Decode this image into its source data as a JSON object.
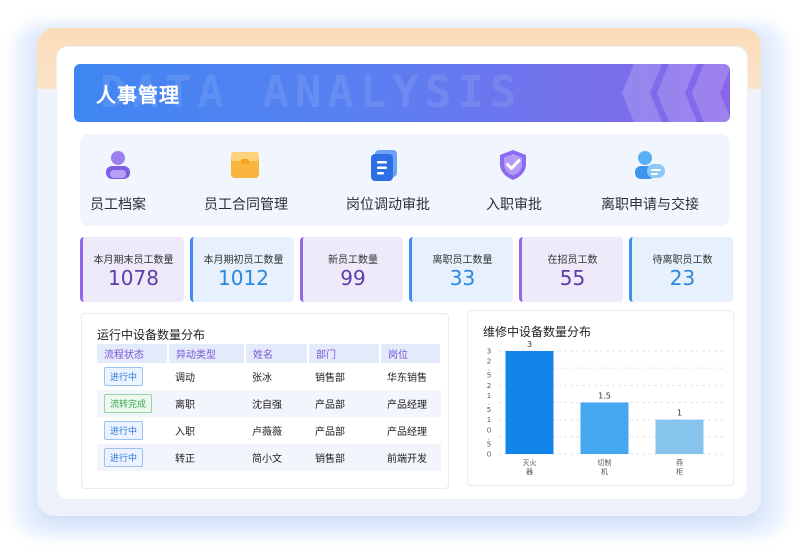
{
  "header": {
    "title": "人事管理",
    "watermark": "DATA ANALYSIS"
  },
  "menu": [
    {
      "label": "员工档案",
      "icon": "user-profile-icon"
    },
    {
      "label": "员工合同管理",
      "icon": "contract-folder-icon"
    },
    {
      "label": "岗位调动审批",
      "icon": "document-icon"
    },
    {
      "label": "入职审批",
      "icon": "shield-check-icon"
    },
    {
      "label": "离职申请与交接",
      "icon": "user-exit-icon"
    }
  ],
  "stats": [
    {
      "label": "本月期末员工数量",
      "value": "1078"
    },
    {
      "label": "本月期初员工数量",
      "value": "1012"
    },
    {
      "label": "新员工数量",
      "value": "99"
    },
    {
      "label": "离职员工数量",
      "value": "33"
    },
    {
      "label": "在招员工数",
      "value": "55"
    },
    {
      "label": "待离职员工数",
      "value": "23"
    }
  ],
  "table_panel": {
    "title": "运行中设备数量分布",
    "columns": [
      "流程状态",
      "异动类型",
      "姓名",
      "部门",
      "岗位"
    ],
    "rows": [
      [
        "进行中",
        "调动",
        "张冰",
        "销售部",
        "华东销售"
      ],
      [
        "流转完成",
        "离职",
        "沈自强",
        "产品部",
        "产品经理"
      ],
      [
        "进行中",
        "入职",
        "卢薇薇",
        "产品部",
        "产品经理"
      ],
      [
        "进行中",
        "转正",
        "简小文",
        "销售部",
        "前端开发"
      ]
    ]
  },
  "chart_panel": {
    "title": "维修中设备数量分布"
  },
  "chart_data": {
    "type": "bar",
    "title": "维修中设备数量分布",
    "categories": [
      "灭火器",
      "切制机",
      "燕柜"
    ],
    "category_label_lines": [
      [
        "灭火",
        "器"
      ],
      [
        "切制",
        "机"
      ],
      [
        "燕",
        "柜"
      ]
    ],
    "values": [
      3,
      1.5,
      1
    ],
    "data_labels": [
      "3",
      "1.5",
      "1"
    ],
    "yticks": [
      "0",
      "0.5",
      "1",
      "1.5",
      "2",
      "2.5",
      "3"
    ],
    "ylim": [
      0,
      3
    ],
    "grid": true,
    "colors": [
      "#1384ea",
      "#44a7f0",
      "#86c4ee"
    ]
  }
}
